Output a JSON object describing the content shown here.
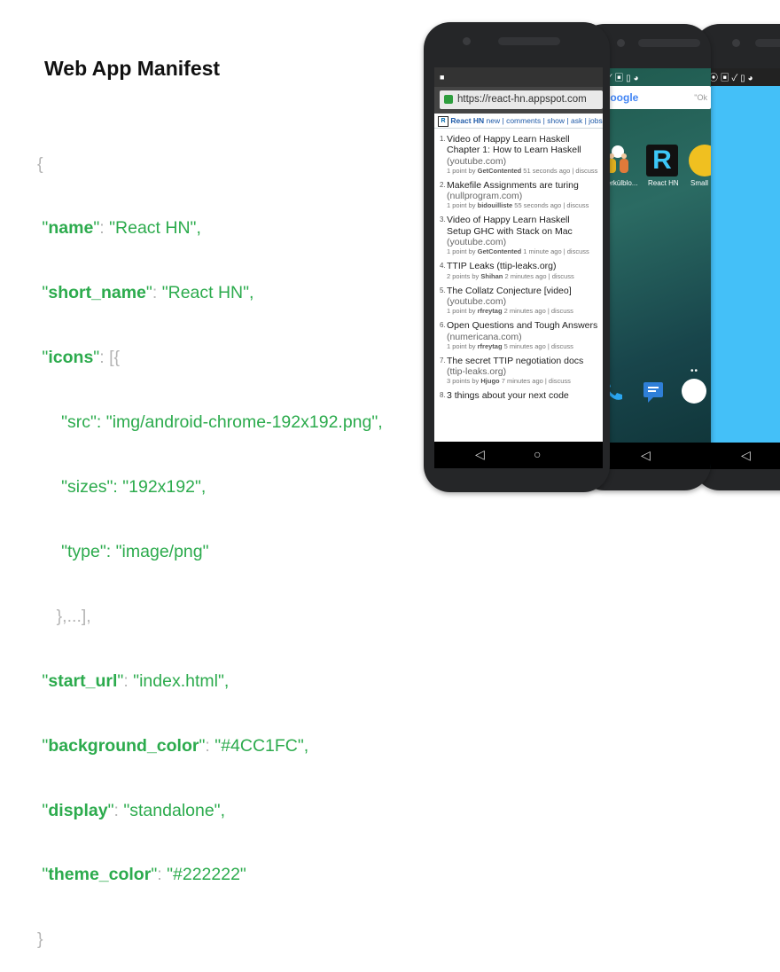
{
  "slide": {
    "title": "Web App Manifest"
  },
  "code": {
    "open_brace": "{",
    "close_brace": "}",
    "name_key": "name",
    "name_val": "\"React HN\",",
    "short_name_key": "short_name",
    "short_name_val": "\"React HN\",",
    "icons_key": "icons",
    "icons_after": ": [{",
    "src_line": "\"src\": \"img/android-chrome-192x192.png\",",
    "sizes_line": "\"sizes\": \"192x192\",",
    "type_line": "\"type\": \"image/png\"",
    "icons_close": "},...],",
    "start_url_key": "start_url",
    "start_url_val": "\"index.html\",",
    "background_color_key": "background_color",
    "background_color_val": "\"#4CC1FC\",",
    "display_key": "display",
    "display_val": "\"standalone\",",
    "theme_color_key": "theme_color",
    "theme_color_val": "\"#222222\""
  },
  "colors": {
    "accent_green": "#2cab4d",
    "splash_bg": "#44c0f8"
  },
  "browser": {
    "url": "https://react-hn.appspot.com",
    "hn_logo": "R",
    "hn_title": "React HN",
    "hn_links": "new | comments | show | ask | jobs",
    "stories": [
      {
        "num": "1.",
        "title": "Video of Happy Learn Haskell",
        "title2": "Chapter 1: How to Learn Haskell",
        "host": "(youtube.com)",
        "meta_pre": "1 point by ",
        "author": "GetContented",
        "meta_post": " 51 seconds ago | discuss"
      },
      {
        "num": "2.",
        "title": "Makefile Assignments are turing",
        "title2": "",
        "host": "(nullprogram.com)",
        "meta_pre": "1 point by ",
        "author": "bidouilliste",
        "meta_post": " 55 seconds ago | discuss"
      },
      {
        "num": "3.",
        "title": "Video of Happy Learn Haskell",
        "title2": "Setup GHC with Stack on Mac",
        "host": "(youtube.com)",
        "meta_pre": "1 point by ",
        "author": "GetContented",
        "meta_post": " 1 minute ago | discuss"
      },
      {
        "num": "4.",
        "title": "TTIP Leaks (ttip-leaks.org)",
        "title2": "",
        "host": "",
        "meta_pre": "2 points by ",
        "author": "Shihan",
        "meta_post": " 2 minutes ago | discuss"
      },
      {
        "num": "5.",
        "title": "The Collatz Conjecture [video]",
        "title2": "",
        "host": "(youtube.com)",
        "meta_pre": "1 point by ",
        "author": "rfreytag",
        "meta_post": " 2 minutes ago | discuss"
      },
      {
        "num": "6.",
        "title": "Open Questions and Tough Answers",
        "title2": "",
        "host": "(numericana.com)",
        "meta_pre": "1 point by ",
        "author": "rfreytag",
        "meta_post": " 5 minutes ago | discuss"
      },
      {
        "num": "7.",
        "title": "The secret TTIP negotiation docs",
        "title2": "",
        "host": "(ttip-leaks.org)",
        "meta_pre": "3 points by ",
        "author": "Hjugo",
        "meta_post": " 7 minutes ago | discuss"
      },
      {
        "num": "8.",
        "title": "3 things about your next code",
        "title2": "",
        "host": "",
        "meta_pre": "",
        "author": "",
        "meta_post": ""
      }
    ]
  },
  "nav": {
    "back": "◁",
    "home": "○"
  },
  "homescreen": {
    "google_label": "Google",
    "ok_google": "\"Ok",
    "apps": [
      {
        "label": "Zuperkülblo..."
      },
      {
        "label": "React HN",
        "glyph": "R"
      },
      {
        "label": "Small"
      }
    ]
  }
}
